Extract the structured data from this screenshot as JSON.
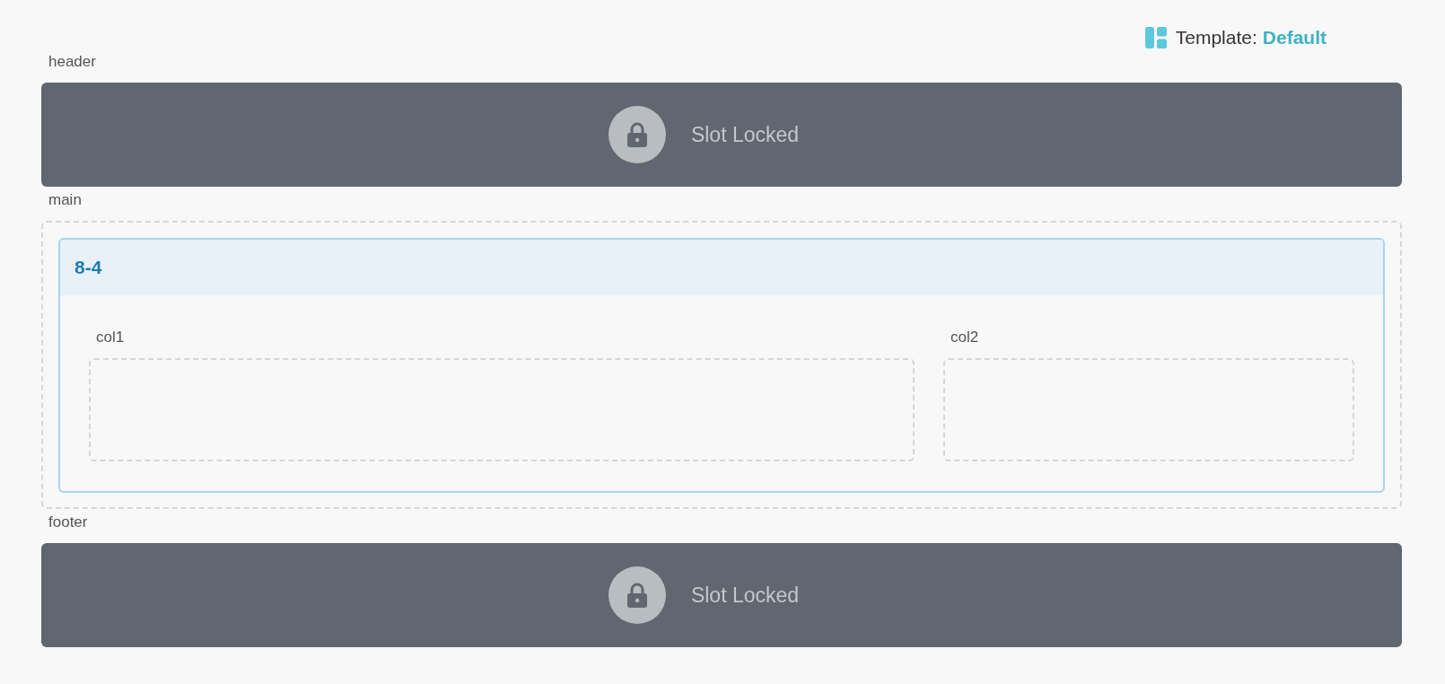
{
  "template": {
    "label": "Template:",
    "value": "Default"
  },
  "slots": [
    {
      "label": "header",
      "kind": "locked",
      "text": "Slot Locked"
    },
    {
      "label": "main",
      "kind": "layout",
      "layout": {
        "title": "8-4",
        "columns": [
          {
            "label": "col1",
            "kind": "wide"
          },
          {
            "label": "col2",
            "kind": "narrow"
          }
        ]
      }
    },
    {
      "label": "footer",
      "kind": "locked",
      "text": "Slot Locked"
    }
  ]
}
